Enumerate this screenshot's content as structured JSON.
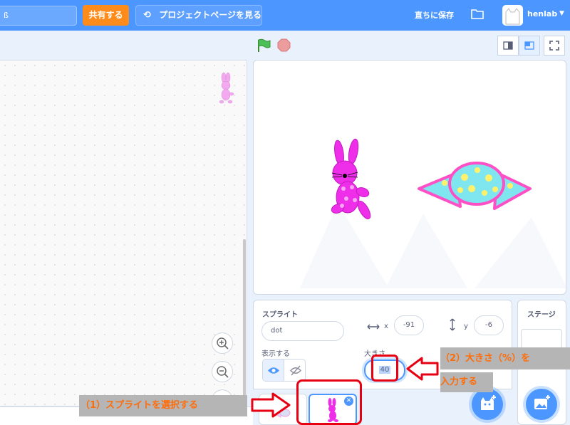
{
  "menubar": {
    "title_value": "ß",
    "share_label": "共有する",
    "project_page_label": "プロジェクトページを見る",
    "save_now_label": "直ちに保存",
    "username": "henlab"
  },
  "icons": {
    "project_page": "arrows-cycle-icon",
    "folder": "folder-icon",
    "green_flag": "green-flag-icon",
    "stop": "stop-icon",
    "zoom_in": "zoom-in-icon",
    "zoom_out": "zoom-out-icon",
    "show": "eye-icon",
    "hide": "eye-slash-icon",
    "choose_sprite": "cat-plus-icon",
    "choose_backdrop": "image-plus-icon"
  },
  "sprite_info": {
    "header": "スプライト",
    "name_value": "dot",
    "x_label": "x",
    "x_value": "-91",
    "y_label": "y",
    "y_value": "-6",
    "show_label": "表示する",
    "size_label": "大きさ",
    "size_value": "40"
  },
  "stage_pane": {
    "title": "ステージ"
  },
  "annotations": {
    "step1": "（1）スプライトを選択する",
    "step2_line1": "（2）大きさ（%）を",
    "step2_line2": "入力する"
  },
  "colors": {
    "menu_blue": "#4c97ff",
    "share_orange": "#ff8c1a",
    "annotation_red": "#e60012",
    "annotation_text_orange": "#ff6c0a",
    "rabbit_pink": "#ee2ee8",
    "candy_cyan": "#7fe6f0"
  }
}
